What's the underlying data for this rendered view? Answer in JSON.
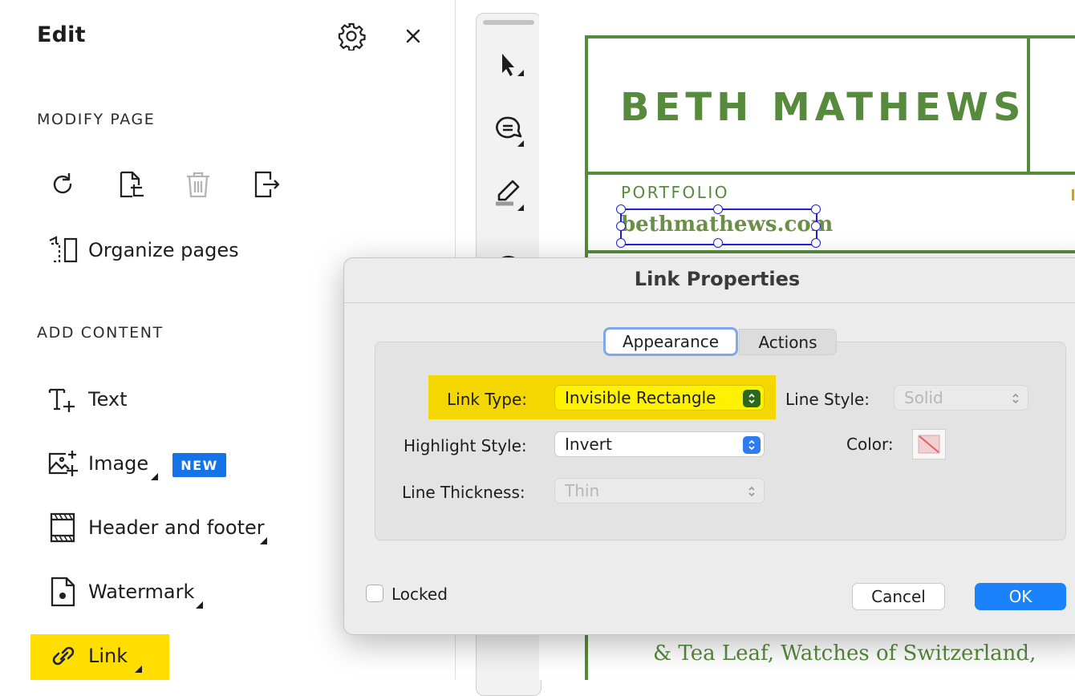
{
  "panel": {
    "title": "Edit",
    "modify_heading": "MODIFY PAGE",
    "organize_label": "Organize pages",
    "add_heading": "ADD CONTENT",
    "items": {
      "text": "Text",
      "image": "Image",
      "header_footer": "Header and footer",
      "watermark": "Watermark",
      "link": "Link"
    },
    "new_badge": "NEW"
  },
  "document": {
    "name": "BETH MATHEWS",
    "portfolio": "PORTFOLIO",
    "url": "bethmathews.com",
    "bottom_text": "& Tea Leaf, Watches of Switzerland,"
  },
  "dialog": {
    "title": "Link Properties",
    "tabs": {
      "appearance": "Appearance",
      "actions": "Actions"
    },
    "link_type_label": "Link Type:",
    "link_type_value": "Invisible Rectangle",
    "line_style_label": "Line Style:",
    "line_style_value": "Solid",
    "highlight_style_label": "Highlight Style:",
    "highlight_style_value": "Invert",
    "color_label": "Color:",
    "line_thickness_label": "Line Thickness:",
    "line_thickness_value": "Thin",
    "locked_label": "Locked",
    "cancel_label": "Cancel",
    "ok_label": "OK"
  },
  "colors": {
    "accent_blue": "#1473e6",
    "highlight_yellow": "#ffde00",
    "doc_green": "#568a3c",
    "ok_blue": "#1a82fb"
  }
}
